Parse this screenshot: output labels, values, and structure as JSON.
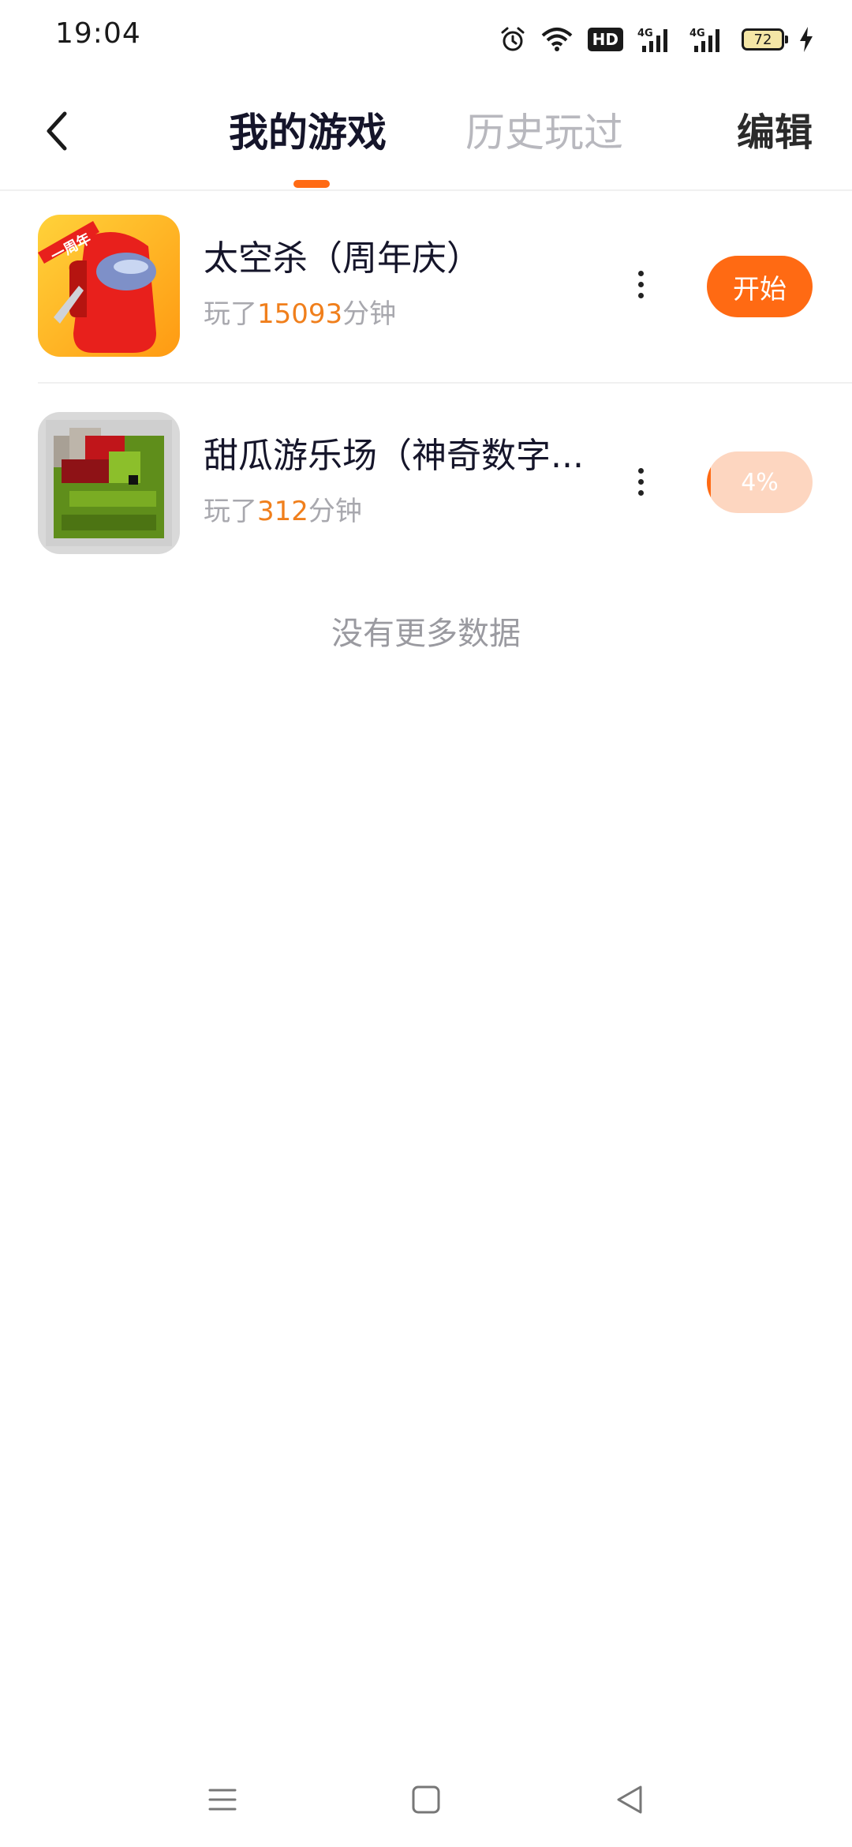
{
  "status_bar": {
    "time": "19:04",
    "hd_label": "HD",
    "network_1": "4G",
    "network_2": "4G",
    "battery": "72",
    "icons": [
      "alarm-icon",
      "wifi-icon",
      "hd-icon",
      "signal-icon",
      "signal-icon",
      "battery-icon",
      "charging-icon"
    ]
  },
  "header": {
    "tabs": [
      {
        "label": "我的游戏",
        "active": true
      },
      {
        "label": "历史玩过",
        "active": false
      }
    ],
    "edit_label": "编辑",
    "accent": "#ff6a13"
  },
  "games": [
    {
      "title": "太空杀（周年庆）",
      "played_prefix": "玩了",
      "minutes": "15093",
      "played_suffix": "分钟",
      "action_label": "开始",
      "icon_badge": "一周年",
      "icon": "among-us-crewmate-icon"
    },
    {
      "title": "甜瓜游乐场（神奇数字...",
      "played_prefix": "玩了",
      "minutes": "312",
      "played_suffix": "分钟",
      "progress_label": "4%",
      "progress": 0.04,
      "icon": "melon-pixel-icon"
    }
  ],
  "footer_text": "没有更多数据",
  "nav_bar": {
    "items": [
      "menu-icon",
      "home-icon",
      "back-triangle-icon"
    ]
  }
}
